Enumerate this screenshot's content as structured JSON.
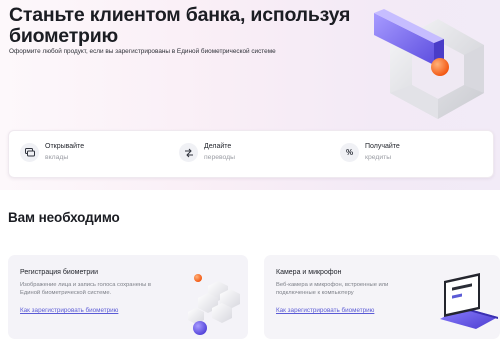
{
  "hero": {
    "title": "Станьте клиентом банка, используя биометрию",
    "subtitle": "Оформите любой продукт, если вы зарегистрированы в Единой биометрической системе"
  },
  "features": [
    {
      "icon": "cards-icon",
      "glyph": "▭",
      "title": "Открывайте",
      "subtitle": "вклады"
    },
    {
      "icon": "transfer-icon",
      "glyph": "⇄",
      "title": "Делайте",
      "subtitle": "переводы"
    },
    {
      "icon": "percent-icon",
      "glyph": "%",
      "title": "Получайте",
      "subtitle": "кредиты"
    }
  ],
  "requirements": {
    "title": "Вам необходимо",
    "cards": [
      {
        "title": "Регистрация биометрии",
        "text": "Изображение лица и запись голоса сохранены в Единой биометрической системе.",
        "link": "Как зарегистрировать биометрию",
        "art": "biometry-cubes"
      },
      {
        "title": "Камера и микрофон",
        "text": "Веб-камера и микрофон, встроенные или подключенные к компьютеру",
        "link": "Как зарегистрировать биометрию",
        "art": "laptop"
      }
    ]
  },
  "colors": {
    "accent": "#5b5bd6",
    "purple": "#7b6cf0",
    "orange": "#ff6a1a",
    "hero_bg": "#f9eef6"
  }
}
